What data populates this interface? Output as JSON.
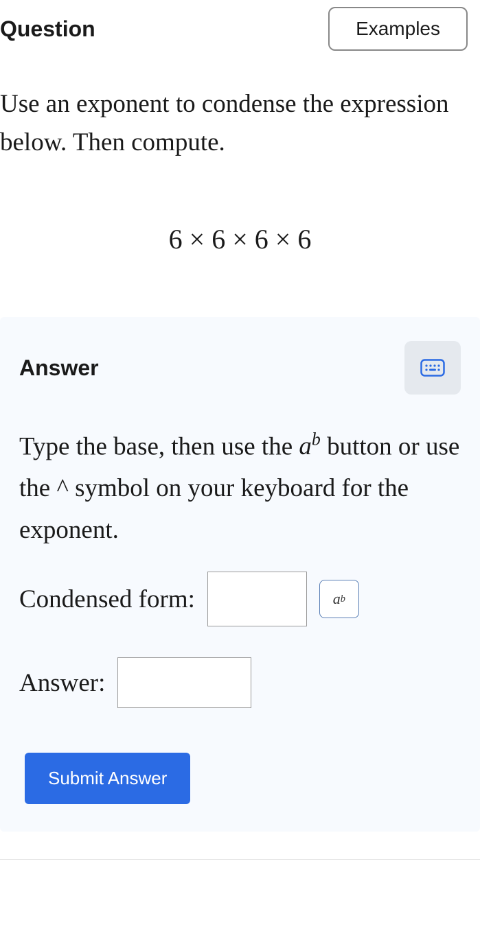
{
  "header": {
    "question_label": "Question",
    "examples_label": "Examples"
  },
  "prompt": "Use an exponent to condense the expression below. Then compute.",
  "expression": "6 × 6 × 6 × 6",
  "answer_panel": {
    "title": "Answer",
    "instruction_part1": "Type the base, then use the ",
    "instruction_ab_base": "a",
    "instruction_ab_sup": "b",
    "instruction_part2": " button or use the ^ symbol on your keyboard for the exponent.",
    "condensed_label": "Condensed form:",
    "condensed_value": "",
    "exp_btn_base": "a",
    "exp_btn_sup": "b",
    "answer_label": "Answer:",
    "answer_value": "",
    "submit_label": "Submit Answer"
  }
}
